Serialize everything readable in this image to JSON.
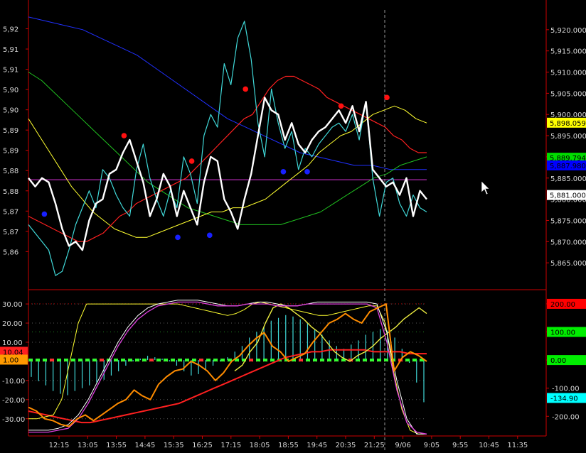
{
  "chart_data": [
    {
      "type": "line",
      "panel": "price",
      "left_axis": {
        "ylim": [
          5.857,
          5.925
        ],
        "ticks": [
          "5,92",
          "5,91",
          "5,91",
          "5,90",
          "5,90",
          "5,89",
          "5,89",
          "5,88",
          "5,88",
          "5,87",
          "5,87",
          "5,86"
        ],
        "tick_values": [
          5.92,
          5.915,
          5.91,
          5.905,
          5.9,
          5.895,
          5.89,
          5.885,
          5.88,
          5.875,
          5.87,
          5.865
        ]
      },
      "right_axis": {
        "ylim": [
          5860,
          5925
        ],
        "ticks": [
          "5,920.000",
          "5,915.000",
          "5,910.000",
          "5,905.000",
          "5,900.000",
          "5,895.000",
          "5,890.000",
          "5,885.000",
          "5,880.000",
          "5,875.000",
          "5,870.000",
          "5,865.000"
        ],
        "tick_values": [
          5920,
          5915,
          5910,
          5905,
          5900,
          5895,
          5890,
          5885,
          5880,
          5875,
          5870,
          5865
        ]
      },
      "value_badges": [
        {
          "label": "5,898.059",
          "value": 5898.059,
          "color": "#ffff00",
          "text_color": "#000000"
        },
        {
          "label": "5,889.794",
          "value": 5889.794,
          "color": "#00dd00",
          "text_color": "#000000"
        },
        {
          "label": "5,887.980",
          "value": 5887.98,
          "color": "#0000ff",
          "text_color": "#000000"
        },
        {
          "label": "5,881.000",
          "value": 5881.0,
          "color": "#ffffff",
          "text_color": "#000000"
        }
      ],
      "horizontal_line": {
        "value": 5884.6,
        "color": "#dd33dd"
      },
      "series": [
        {
          "color": "#ffffff",
          "width": 2.4,
          "y": [
            5885,
            5883,
            5885,
            5884,
            5879,
            5873,
            5869,
            5870,
            5868,
            5875,
            5879,
            5880,
            5886,
            5887,
            5891,
            5894,
            5889,
            5884,
            5876,
            5880,
            5886,
            5883,
            5876,
            5882,
            5878,
            5874,
            5884,
            5890,
            5889,
            5880,
            5877,
            5873,
            5880,
            5886,
            5895,
            5904,
            5901,
            5900,
            5894,
            5898,
            5893,
            5891,
            5894,
            5896,
            5897,
            5899,
            5901,
            5898,
            5902,
            5896,
            5903,
            5887,
            5885,
            5883,
            5884,
            5881,
            5885,
            5876,
            5882,
            5880
          ]
        },
        {
          "color": "#40d8d8",
          "width": 1.2,
          "y": [
            5874,
            5872,
            5870,
            5868,
            5862,
            5863,
            5868,
            5874,
            5878,
            5882,
            5878,
            5887,
            5885,
            5881,
            5878,
            5876,
            5887,
            5893,
            5885,
            5880,
            5876,
            5882,
            5878,
            5890,
            5886,
            5879,
            5895,
            5900,
            5897,
            5912,
            5907,
            5918,
            5922,
            5913,
            5898,
            5890,
            5906,
            5898,
            5892,
            5896,
            5887,
            5892,
            5890,
            5893,
            5895,
            5897,
            5898,
            5896,
            5900,
            5894,
            5903,
            5885,
            5876,
            5884,
            5885,
            5879,
            5876,
            5881,
            5878,
            5877
          ]
        },
        {
          "color": "#ff2020",
          "width": 1.2,
          "y": [
            5876,
            5875,
            5874,
            5873,
            5872,
            5871,
            5870,
            5870,
            5871,
            5872,
            5874,
            5876,
            5877,
            5879,
            5880,
            5881,
            5882,
            5883,
            5884,
            5885,
            5887,
            5889,
            5891,
            5893,
            5895,
            5897,
            5899,
            5900,
            5903,
            5906,
            5908,
            5909,
            5909,
            5908,
            5907,
            5906,
            5904,
            5903,
            5902,
            5901,
            5900,
            5899,
            5898,
            5897,
            5895,
            5894,
            5892,
            5891,
            5891
          ]
        },
        {
          "color": "#ffff30",
          "width": 1.0,
          "y": [
            5899,
            5895,
            5891,
            5887,
            5883,
            5880,
            5877,
            5875,
            5873,
            5872,
            5871,
            5871,
            5872,
            5873,
            5874,
            5875,
            5876,
            5877,
            5877,
            5878,
            5878,
            5879,
            5880,
            5882,
            5884,
            5886,
            5888,
            5891,
            5893,
            5895,
            5896,
            5898,
            5900,
            5901,
            5902,
            5901,
            5899,
            5898
          ]
        },
        {
          "color": "#20c020",
          "width": 1.0,
          "y": [
            5910,
            5908,
            5905,
            5902,
            5899,
            5896,
            5893,
            5890,
            5887,
            5884,
            5882,
            5880,
            5878,
            5877,
            5876,
            5875,
            5874,
            5874,
            5874,
            5874,
            5875,
            5876,
            5877,
            5879,
            5881,
            5883,
            5885,
            5886,
            5888,
            5889,
            5890
          ]
        },
        {
          "color": "#2030ff",
          "width": 1.0,
          "y": [
            5923,
            5922,
            5921,
            5920,
            5918,
            5916,
            5914,
            5911,
            5908,
            5905,
            5902,
            5899,
            5897,
            5895,
            5893,
            5891,
            5890,
            5889,
            5888,
            5888,
            5887,
            5887,
            5887
          ]
        }
      ],
      "markers": [
        {
          "x_frac": 0.04,
          "value": 5876.5,
          "color": "#1820ff"
        },
        {
          "x_frac": 0.24,
          "value": 5895.0,
          "color": "#ff1010"
        },
        {
          "x_frac": 0.375,
          "value": 5871.0,
          "color": "#1820ff"
        },
        {
          "x_frac": 0.41,
          "value": 5889.0,
          "color": "#ff1010"
        },
        {
          "x_frac": 0.455,
          "value": 5871.5,
          "color": "#1820ff"
        },
        {
          "x_frac": 0.545,
          "value": 5906.0,
          "color": "#ff1010"
        },
        {
          "x_frac": 0.64,
          "value": 5886.5,
          "color": "#1820ff"
        },
        {
          "x_frac": 0.7,
          "value": 5886.5,
          "color": "#1820ff"
        },
        {
          "x_frac": 0.785,
          "value": 5902.0,
          "color": "#ff1010"
        },
        {
          "x_frac": 0.9,
          "value": 5904.0,
          "color": "#ff1010"
        }
      ]
    },
    {
      "type": "line",
      "panel": "oscillator",
      "left_axis": {
        "ylim": [
          -39,
          33
        ],
        "ticks": [
          "30.00",
          "20.00",
          "10.00",
          "0.00",
          "-10.00",
          "-20.00",
          "-30.00"
        ],
        "tick_values": [
          30,
          20,
          10,
          0,
          -10,
          -20,
          -30
        ]
      },
      "right_axis": {
        "ylim": [
          -270,
          220
        ],
        "ticks": [
          "200.00",
          "100.00",
          "0.00",
          "-100.00",
          "-200.00"
        ],
        "tick_values": [
          200,
          100,
          0,
          -100,
          -200
        ]
      },
      "left_badges": [
        {
          "label": "10.04",
          "value": 5.0,
          "color": "#ff2020",
          "text_color": "#000000"
        },
        {
          "label": "1.00",
          "value": 0.9,
          "color": "#ff9a00",
          "text_color": "#000000"
        }
      ],
      "value_badges": [
        {
          "label": "200.00",
          "value": 200,
          "color": "#ff0000",
          "text_color": "#000000"
        },
        {
          "label": "100.00",
          "value": 100,
          "color": "#00ee00",
          "text_color": "#000000"
        },
        {
          "label": "0.00",
          "value": 0,
          "color": "#00ee00",
          "text_color": "#000000"
        },
        {
          "label": "-134.90",
          "value": -134.9,
          "color": "#00ffff",
          "text_color": "#000000"
        }
      ],
      "histogram": {
        "color": "#40d8d8",
        "values": [
          -60,
          -75,
          -90,
          -110,
          -120,
          -125,
          -110,
          -100,
          -90,
          -80,
          -70,
          -55,
          -40,
          -20,
          -5,
          5,
          15,
          10,
          5,
          -5,
          -20,
          -40,
          -55,
          -50,
          -35,
          -20,
          -5,
          10,
          30,
          50,
          80,
          100,
          120,
          140,
          150,
          160,
          155,
          145,
          130,
          110,
          90,
          70,
          50,
          40,
          55,
          70,
          90,
          100,
          110,
          105,
          80,
          40,
          -10,
          -80,
          -150
        ]
      },
      "series": [
        {
          "color": "#ffff30",
          "width": 1.0,
          "y": [
            -30,
            -30,
            -29,
            -28,
            -20,
            0,
            20,
            30,
            30,
            30,
            30,
            30,
            30,
            30,
            30,
            30,
            30,
            30,
            30,
            29,
            28,
            27,
            26,
            25,
            24,
            25,
            27,
            30,
            31,
            30,
            29,
            28,
            27,
            26,
            25,
            24,
            24,
            25,
            26,
            27,
            28,
            29,
            29,
            20,
            -5,
            -25,
            -36,
            -38,
            -38
          ]
        },
        {
          "color": "#ffffff",
          "width": 1.0,
          "y": [
            -36,
            -36,
            -36,
            -35,
            -33,
            -28,
            -20,
            -10,
            0,
            10,
            18,
            24,
            28,
            30,
            31,
            32,
            32,
            32,
            31,
            30,
            29,
            29,
            30,
            31,
            31,
            30,
            29,
            29,
            30,
            31,
            31,
            31,
            31,
            31,
            31,
            30,
            15,
            -10,
            -30,
            -38,
            -38
          ]
        },
        {
          "color": "#e040e0",
          "width": 1.3,
          "y": [
            -37,
            -37,
            -37,
            -36,
            -35,
            -30,
            -22,
            -12,
            -2,
            8,
            16,
            22,
            26,
            29,
            30,
            31,
            31,
            31,
            30,
            29,
            29,
            29,
            30,
            30,
            30,
            29,
            29,
            29,
            30,
            30,
            30,
            30,
            30,
            30,
            30,
            28,
            10,
            -15,
            -32,
            -37,
            -38
          ]
        },
        {
          "color": "#ff2020",
          "width": 2.0,
          "y": [
            -26,
            -27,
            -28,
            -29,
            -30,
            -31,
            -32,
            -32,
            -31,
            -30,
            -29,
            -28,
            -27,
            -26,
            -25,
            -24,
            -23,
            -22,
            -20,
            -18,
            -16,
            -14,
            -12,
            -10,
            -8,
            -6,
            -4,
            -2,
            0,
            2,
            3,
            4,
            5,
            5,
            6,
            6,
            6,
            6,
            6,
            5,
            5,
            5,
            5,
            4,
            4,
            4
          ]
        },
        {
          "color": "#ff8c00",
          "width": 2.0,
          "y": [
            -24,
            -26,
            -30,
            -31,
            -33,
            -34,
            -30,
            -28,
            -31,
            -28,
            -25,
            -22,
            -20,
            -15,
            -18,
            -20,
            -12,
            -8,
            -5,
            -4,
            0,
            -2,
            -5,
            -10,
            -6,
            0,
            3,
            8,
            12,
            15,
            8,
            5,
            0,
            2,
            4,
            10,
            15,
            20,
            22,
            25,
            22,
            20,
            26,
            28,
            30,
            -5,
            2,
            5,
            3,
            0
          ]
        },
        {
          "color": "#eeee40",
          "width": 1.4,
          "y": [
            -5,
            -2,
            5,
            10,
            20,
            28,
            30,
            28,
            25,
            22,
            18,
            15,
            10,
            5,
            2,
            0,
            3,
            5,
            8,
            12,
            15,
            18,
            22,
            25,
            28,
            25
          ]
        }
      ]
    }
  ],
  "x_axis": {
    "ticks": [
      "12:15",
      "13:05",
      "13:55",
      "14:45",
      "15:35",
      "16:25",
      "17:15",
      "18:05",
      "18:55",
      "19:45",
      "20:35",
      "21:25",
      "9/06",
      "9:05",
      "9:55",
      "10:45",
      "11:35"
    ]
  },
  "colors": {
    "background": "#000000",
    "frame": "#cc0000",
    "text": "#d8d8d8",
    "grid_dot": "#5a5a5a"
  }
}
